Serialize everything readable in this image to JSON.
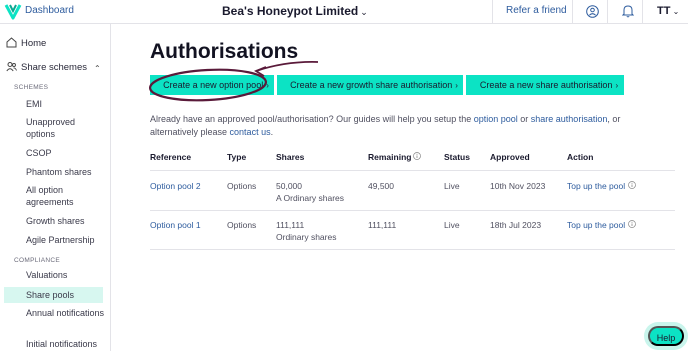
{
  "topbar": {
    "dashboard_label": "Dashboard",
    "company_name": "Bea's Honeypot Limited",
    "refer_label": "Refer a friend",
    "initials": "TT"
  },
  "sidebar": {
    "home": "Home",
    "share_schemes": "Share schemes",
    "section_schemes": "SCHEMES",
    "items": [
      "EMI",
      "Unapproved options",
      "CSOP",
      "Phantom shares",
      "All option agreements",
      "Growth shares",
      "Agile Partnership"
    ],
    "section_compliance": "COMPLIANCE",
    "compliance_items": [
      "Valuations",
      "Share pools",
      "Annual notifications",
      "Initial notifications"
    ]
  },
  "main": {
    "title": "Authorisations",
    "buttons": {
      "new_option_pool": "Create a new option pool",
      "new_growth_share": "Create a new growth share authorisation",
      "new_share": "Create a new share authorisation"
    },
    "intro": {
      "part1": "Already have an approved pool/authorisation? Our guides will help you setup the ",
      "link1": "option pool",
      "part2": " or ",
      "link2": "share authorisation",
      "part3": ", or alternatively please ",
      "link3": "contact us",
      "part4": "."
    },
    "table": {
      "headers": {
        "reference": "Reference",
        "type": "Type",
        "shares": "Shares",
        "remaining": "Remaining",
        "status": "Status",
        "approved": "Approved",
        "action": "Action"
      },
      "rows": [
        {
          "reference": "Option pool 2",
          "type": "Options",
          "shares": "50,000",
          "share_class": "A Ordinary shares",
          "remaining": "49,500",
          "status": "Live",
          "approved": "10th Nov 2023",
          "action": "Top up the pool"
        },
        {
          "reference": "Option pool 1",
          "type": "Options",
          "shares": "111,111",
          "share_class": "Ordinary shares",
          "remaining": "111,111",
          "status": "Live",
          "approved": "18th Jul 2023",
          "action": "Top up the pool"
        }
      ]
    }
  },
  "help_label": "Help",
  "icons": {
    "logo": "vestd-v-logo",
    "user": "user-circle-icon",
    "bell": "bell-icon",
    "info": "info-icon"
  },
  "colors": {
    "accent": "#0ce3c4",
    "link": "#2e5c9e",
    "active_bg": "#d7f7f0",
    "annotation": "#5a1a3a"
  }
}
